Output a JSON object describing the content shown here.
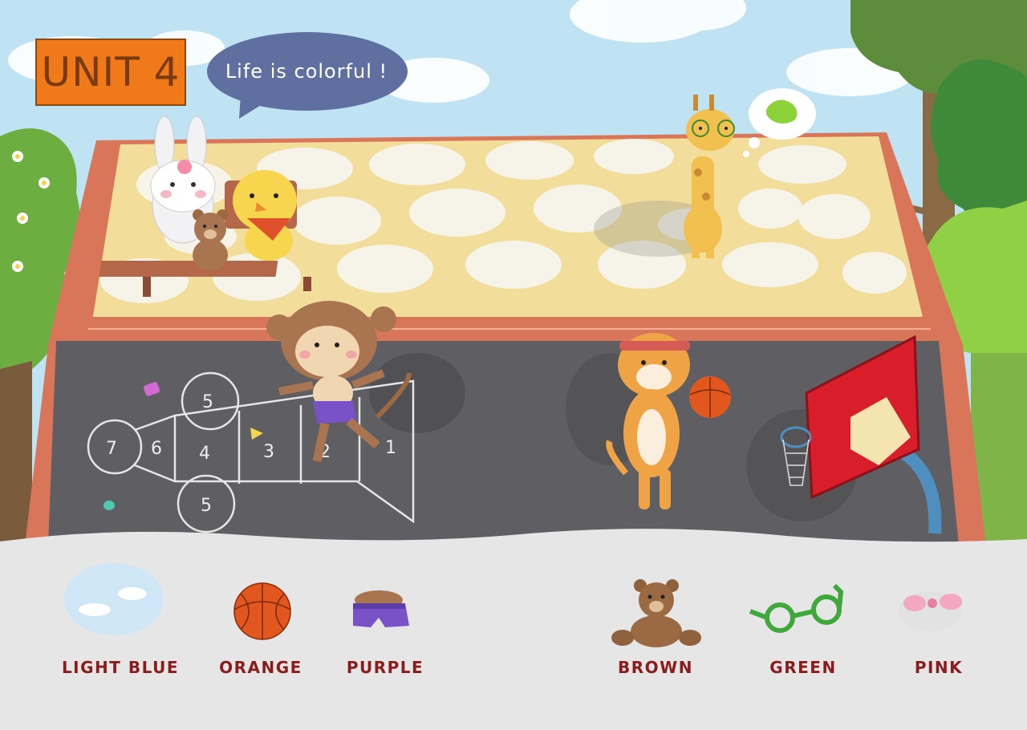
{
  "title": {
    "unit_label": "UNIT 4",
    "badge_color": "#f07a1a"
  },
  "speech_bubble": {
    "text": "Life is colorful !",
    "color": "#5f6fa0"
  },
  "hopscotch_numbers": [
    "1",
    "2",
    "3",
    "4",
    "5",
    "5",
    "6",
    "7"
  ],
  "characters": [
    "rabbit-icon",
    "teddy-bear-icon",
    "chick-icon",
    "giraffe-icon",
    "monkey-icon",
    "tiger-icon"
  ],
  "vocabulary": [
    {
      "label": "LIGHT BLUE",
      "icon": "sky-icon",
      "color": "#cfe6f7"
    },
    {
      "label": "ORANGE",
      "icon": "basketball-icon",
      "color": "#e2571d"
    },
    {
      "label": "PURPLE",
      "icon": "shorts-icon",
      "color": "#7a52c7"
    },
    {
      "label": "BROWN",
      "icon": "teddy-bear-icon",
      "color": "#9b6a43"
    },
    {
      "label": "GREEN",
      "icon": "glasses-icon",
      "color": "#3fa83a"
    },
    {
      "label": "PINK",
      "icon": "hair-bow-icon",
      "color": "#f3a7c0"
    }
  ],
  "label_color": "#8a1c1c"
}
